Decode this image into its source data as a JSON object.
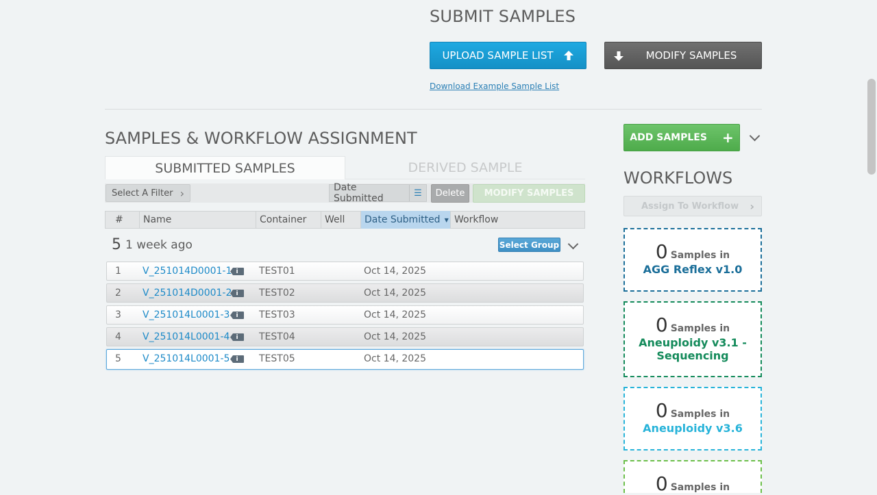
{
  "submit": {
    "title": "SUBMIT SAMPLES",
    "upload_label": "UPLOAD SAMPLE LIST",
    "modify_label": "MODIFY SAMPLES",
    "download_link": "Download Example Sample List"
  },
  "samples": {
    "title": "SAMPLES & WORKFLOW ASSIGNMENT",
    "tabs": [
      {
        "label": "SUBMITTED SAMPLES"
      },
      {
        "label": "DERIVED SAMPLE"
      }
    ],
    "filter_label": "Select A Filter",
    "sort_label": "Date Submitted",
    "delete_label": "Delete",
    "modify_label": "MODIFY SAMPLES",
    "columns": [
      "#",
      "Name",
      "Container",
      "Well",
      "Date Submitted",
      "Workflow"
    ],
    "group": {
      "count": "5",
      "label": "1 week ago",
      "select_label": "Select Group"
    },
    "rows": [
      {
        "num": "1",
        "name": "V_251014D0001-1",
        "container": "TEST01",
        "date": "Oct 14, 2025"
      },
      {
        "num": "2",
        "name": "V_251014D0001-2",
        "container": "TEST02",
        "date": "Oct 14, 2025"
      },
      {
        "num": "3",
        "name": "V_251014L0001-3",
        "container": "TEST03",
        "date": "Oct 14, 2025"
      },
      {
        "num": "4",
        "name": "V_251014L0001-4",
        "container": "TEST04",
        "date": "Oct 14, 2025"
      },
      {
        "num": "5",
        "name": "V_251014L0001-5",
        "container": "TEST05",
        "date": "Oct 14, 2025"
      }
    ]
  },
  "sidebar": {
    "add_label": "ADD SAMPLES",
    "workflows_title": "WORKFLOWS",
    "assign_label": "Assign To Workflow",
    "samples_in": "Samples in",
    "workflows": [
      {
        "count": "0",
        "name": "AGG Reflex v1.0",
        "color": "#1a6e99"
      },
      {
        "count": "0",
        "name": "Aneuploidy v3.1 - Sequencing",
        "color": "#138a5a"
      },
      {
        "count": "0",
        "name": "Aneuploidy v3.6",
        "color": "#27b3d9"
      },
      {
        "count": "0",
        "name": "",
        "color": "#6cbf4a"
      }
    ]
  },
  "colors": {
    "primary": "#1590c6",
    "success": "#4eab4b",
    "dark_button": "#555555"
  }
}
